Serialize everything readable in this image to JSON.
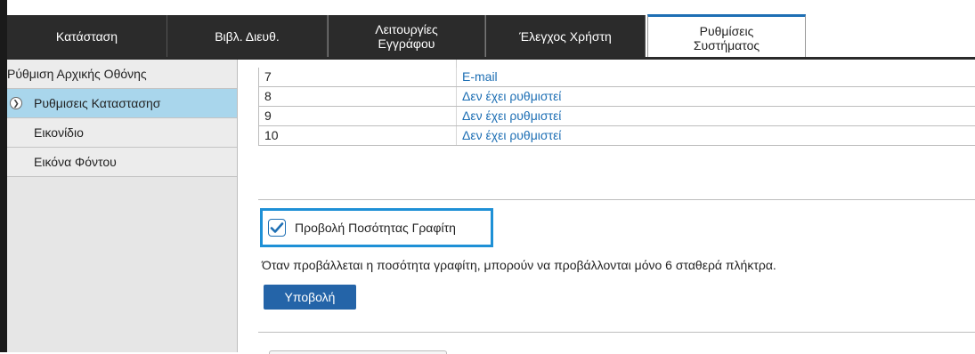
{
  "tabs": [
    {
      "label": "Κατάσταση"
    },
    {
      "label": "Βιβλ. Διευθ."
    },
    {
      "label": "Λειτουργίες Εγγράφου"
    },
    {
      "label": "Έλεγχος Χρήστη"
    },
    {
      "label": "Ρυθμίσεις Συστήματος"
    }
  ],
  "sidebar": {
    "items": [
      {
        "label": "Ρύθμιση Αρχικής Οθόνης"
      },
      {
        "label": "Ρυθμισεις Καταστασησ"
      },
      {
        "label": "Εικονίδιο"
      },
      {
        "label": "Εικόνα Φόντου"
      }
    ]
  },
  "keys_table": {
    "rows": [
      {
        "num": "7",
        "value": "E-mail"
      },
      {
        "num": "8",
        "value": "Δεν έχει ρυθμιστεί"
      },
      {
        "num": "9",
        "value": "Δεν έχει ρυθμιστεί"
      },
      {
        "num": "10",
        "value": "Δεν έχει ρυθμιστεί"
      }
    ]
  },
  "toner": {
    "checkbox_label": "Προβολή Ποσότητας Γραφίτη",
    "checked": true,
    "note": "Όταν προβάλλεται η ποσότητα γραφίτη, μπορούν να προβάλλονται μόνο 6 σταθερά πλήκτρα."
  },
  "submit_label": "Υποβολή",
  "colors": {
    "accent": "#1e6fb4",
    "highlight": "#1e90d6",
    "selected": "#a9d6ec"
  }
}
